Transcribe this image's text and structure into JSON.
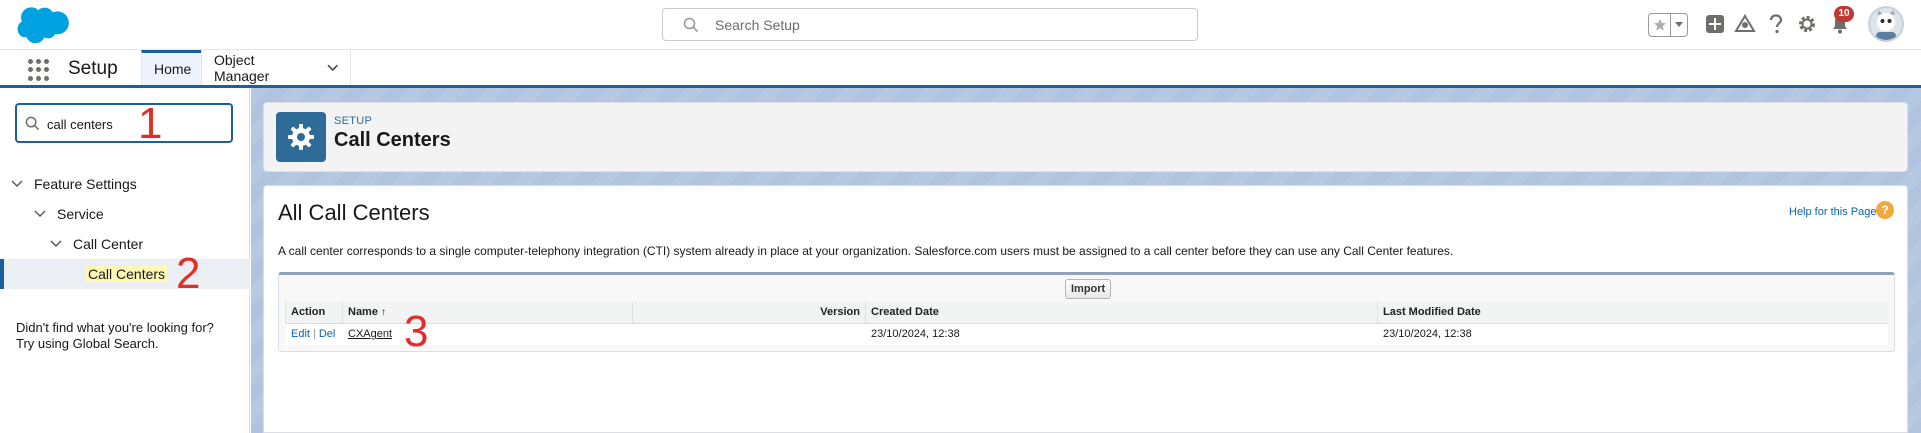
{
  "header": {
    "search_placeholder": "Search Setup",
    "notification_count": "10"
  },
  "nav": {
    "app_name": "Setup",
    "tabs": [
      {
        "label": "Home",
        "active": true
      },
      {
        "label": "Object Manager",
        "active": false
      }
    ]
  },
  "sidebar": {
    "quickfind_value": "call centers",
    "tree": [
      {
        "label": "Feature Settings",
        "level": 0
      },
      {
        "label": "Service",
        "level": 1
      },
      {
        "label": "Call Center",
        "level": 2
      },
      {
        "label": "Call Centers",
        "level": 3,
        "selected": true
      }
    ],
    "not_found_line1": "Didn't find what you're looking for?",
    "not_found_line2": "Try using Global Search."
  },
  "annotations": [
    "1",
    "2",
    "3"
  ],
  "page_header": {
    "breadcrumb": "SETUP",
    "title": "Call Centers"
  },
  "content": {
    "title": "All Call Centers",
    "help_link": "Help for this Page",
    "description": "A call center corresponds to a single computer-telephony integration (CTI) system already in place at your organization. Salesforce.com users must be assigned to a call center before they can use any Call Center features.",
    "import_label": "Import",
    "table": {
      "columns": [
        "Action",
        "Name",
        "Version",
        "Created Date",
        "Last Modified Date"
      ],
      "sort_indicator": "↑",
      "rows": [
        {
          "edit": "Edit",
          "sep": "|",
          "del": "Del",
          "name": "CXAgent",
          "version": "",
          "created": "23/10/2024, 12:38",
          "modified": "23/10/2024, 12:38"
        }
      ]
    }
  },
  "colors": {
    "brand_blue": "#1b5f9e",
    "link_blue": "#0b61b5",
    "salesforce_cloud": "#00a1e0",
    "annotation_red": "#e32e27",
    "badge_red": "#c23934"
  }
}
